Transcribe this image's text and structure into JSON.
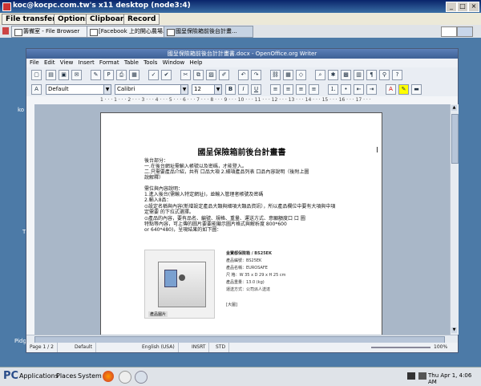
{
  "vnc": {
    "title": "koc@kocpc.com.tw's x11 desktop (node3:4)",
    "menu": [
      "File transfer",
      "Options",
      "Clipboard",
      "Record"
    ]
  },
  "taskbar": {
    "tasks": [
      {
        "label": "籌備室 - File Browser",
        "active": false
      },
      {
        "label": "[Facebook 上的開心農場...",
        "active": false
      },
      {
        "label": "國呈保險箱前後台計畫...",
        "active": true
      }
    ]
  },
  "desktop": {
    "labels": [
      "ko",
      "Pidg",
      "T"
    ]
  },
  "writer": {
    "title": "國呈保險箱前後台計計畫書.docx - OpenOffice.org Writer",
    "menu": [
      "File",
      "Edit",
      "View",
      "Insert",
      "Format",
      "Table",
      "Tools",
      "Window",
      "Help"
    ],
    "style": "Default",
    "font": "Calibri",
    "size": "12",
    "ruler": "1 · · · 1 · · · 2 · · · 3 · · · 4 · · · 5 · · · 6 · · · 7 · · · 8 · · · 9 · · · 10 · · · 11 · · · 12 · · · 13 · · · 14 · · · 15 · · · 16 · · · 17 · · ·",
    "status": {
      "page": "Page 1 / 2",
      "pagestyle": "Default",
      "language": "English (USA)",
      "mode": "INSRT",
      "selection": "STD",
      "zoom": "100%"
    }
  },
  "document": {
    "heading": "國呈保險箱前後台計畫書",
    "lines": [
      "後台部分：",
      "一.在後台網址需輸入帳號以及密碼，才能登入。",
      "二.只需要產品介紹，共有 口品大項 2.細項產品列表 口品內容說明（後附上圖",
      "說解釋）",
      "",
      "需位與內容說明：",
      "1.進入後台(需輸入特定網址)，並輸入管理者帳號及密碼",
      "2.輸入8品：",
      "⊙設定名稱與內容(新增設定產品大類與細項大類品資訊），所以產品欄位中要有大項與中項",
      "定需要 的下拉式選擇。",
      "⊙產品的內容，要有品名、編號、規格、重量、運送方式、意願額度口 口 圖",
      "特點等內容，可上傳的圖片要要能顯示圖片格式與解析度 800*600",
      "or 640*480)，呈現結果的如下圖："
    ],
    "specs": [
      "金寶都保險箱 / BS25EK",
      "產品編號：BS25EK",
      "產品名稱：EUROSAFE",
      "尺    格：W 35 x D 29 x H 25 cm",
      "產品重量：13.0 (kg)",
      "運送方式：公司派人送達",
      "",
      "[大圖]"
    ],
    "photo_caption": "產品圖片"
  },
  "panel": {
    "apps": "Applications",
    "places": "Places",
    "system": "System",
    "clock": "Thu Apr 1,  4:06 AM"
  }
}
